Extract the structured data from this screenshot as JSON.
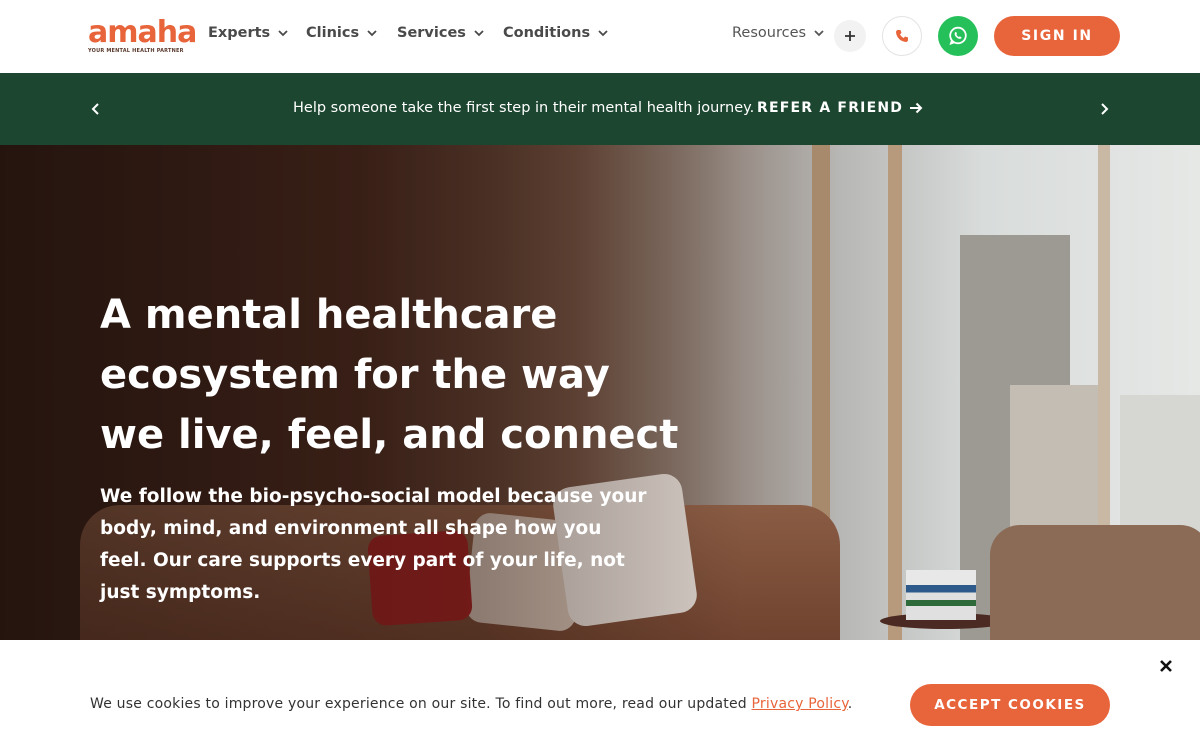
{
  "brand": {
    "name": "amaha",
    "tagline": "YOUR MENTAL HEALTH PARTNER",
    "accent_color": "#e8643a",
    "banner_color": "#1d4630",
    "whatsapp_color": "#25c05a"
  },
  "nav": {
    "items": [
      {
        "label": "Experts"
      },
      {
        "label": "Clinics"
      },
      {
        "label": "Services"
      },
      {
        "label": "Conditions"
      },
      {
        "label": "Resources"
      }
    ],
    "icons": [
      "plus-icon",
      "phone-icon",
      "whatsapp-icon"
    ],
    "signin_label": "SIGN IN"
  },
  "banner": {
    "text": "Help someone take the first step in their mental health journey.",
    "link_label": "REFER A FRIEND"
  },
  "hero": {
    "title": "A mental healthcare ecosystem for the way we live, feel, and connect",
    "subtitle": "We follow the bio-psycho-social model because your body, mind, and environment all shape how you feel. Our care supports every part of your life, not just symptoms."
  },
  "cookie": {
    "text": "We use cookies to improve your experience on our site. To find out more, read our updated ",
    "link_label": "Privacy Policy",
    "after_link": ".",
    "accept_label": "ACCEPT COOKIES"
  }
}
